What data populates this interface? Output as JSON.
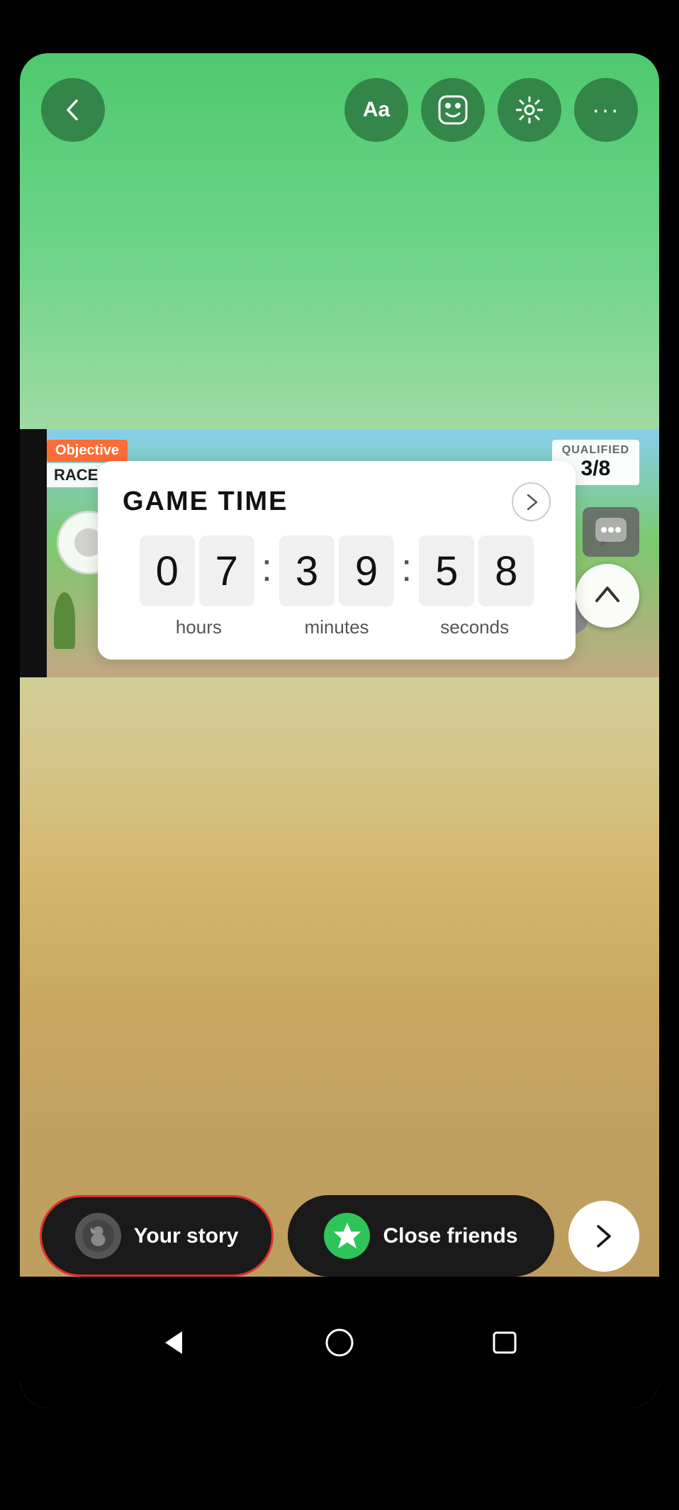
{
  "toolbar": {
    "back_label": "‹",
    "text_btn": "Aa",
    "sticker_btn": "sticker",
    "effects_btn": "sparkle",
    "more_btn": "•••"
  },
  "game_widget": {
    "title": "GAME TIME",
    "hours_d1": "0",
    "hours_d2": "7",
    "minutes_d1": "3",
    "minutes_d2": "9",
    "seconds_d1": "5",
    "seconds_d2": "8",
    "label_hours": "hours",
    "label_minutes": "minutes",
    "label_seconds": "seconds"
  },
  "game_hud": {
    "objective_label": "Objective",
    "race_text": "RACE TO FI",
    "qualified_label": "QUALIFIED",
    "qualified_score": "3/8"
  },
  "bottom_bar": {
    "story_label": "Your story",
    "friends_label": "Close friends",
    "next_label": "›"
  },
  "colors": {
    "green_accent": "#2ec45a",
    "red_border": "#e03030",
    "dark_bg": "#1a1a1a",
    "widget_bg": "#ffffff",
    "toolbar_btn": "rgba(40,110,60,0.75)"
  }
}
